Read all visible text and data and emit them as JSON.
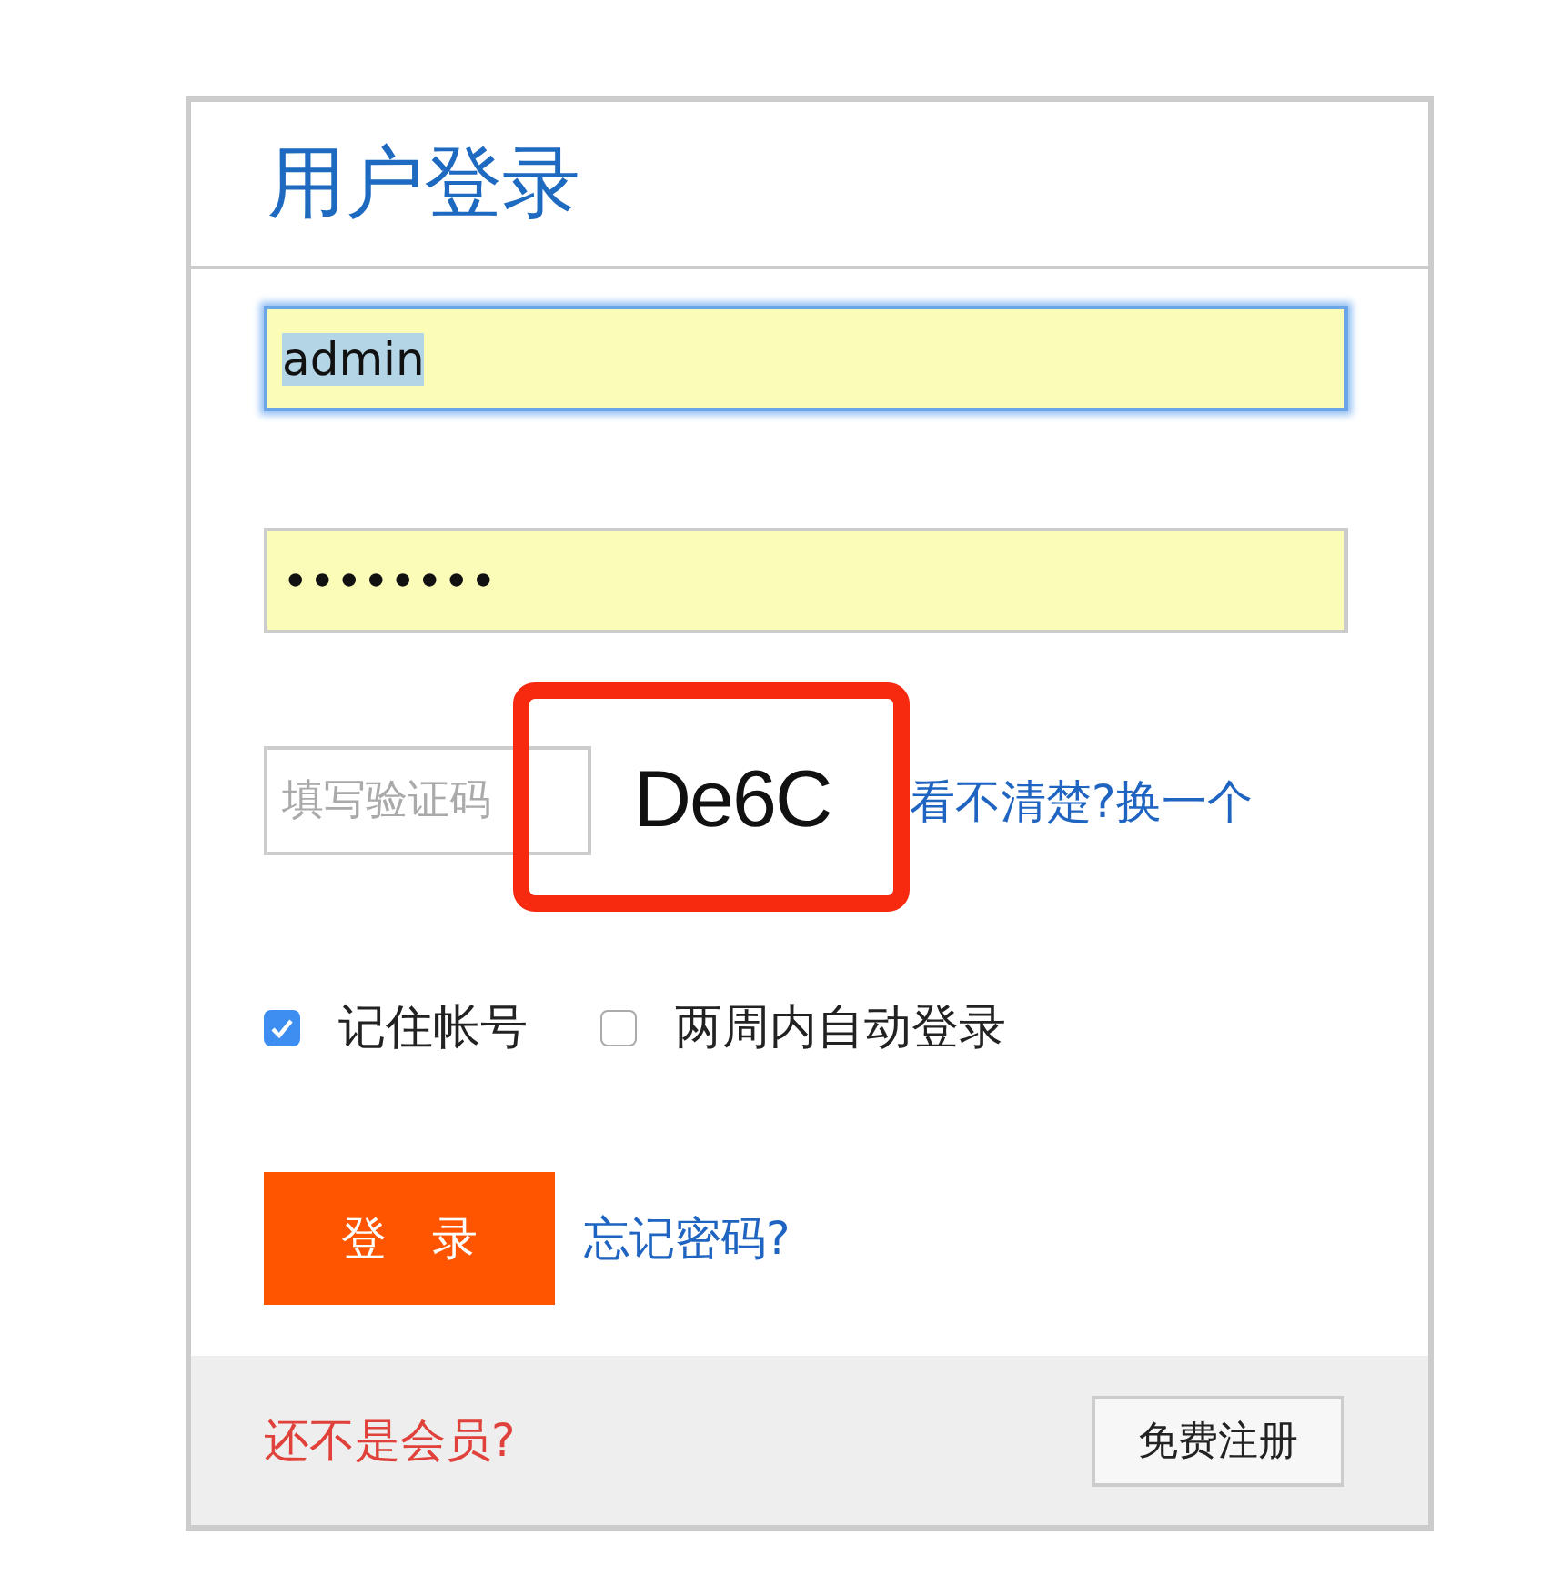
{
  "title": "用户登录",
  "username": {
    "value": "admin",
    "focused": true,
    "text_selected": true
  },
  "password": {
    "value": "••••••••",
    "focused": false
  },
  "captcha": {
    "placeholder": "填写验证码",
    "code": "De6C",
    "refresh_link": "看不清楚?换一个",
    "highlighted": true
  },
  "options": [
    {
      "label": "记住帐号",
      "checked": true
    },
    {
      "label": "两周内自动登录",
      "checked": false
    }
  ],
  "login_button": "登　录",
  "forgot_link": "忘记密码?",
  "footer": {
    "prompt": "还不是会员?",
    "register_button": "免费注册"
  }
}
